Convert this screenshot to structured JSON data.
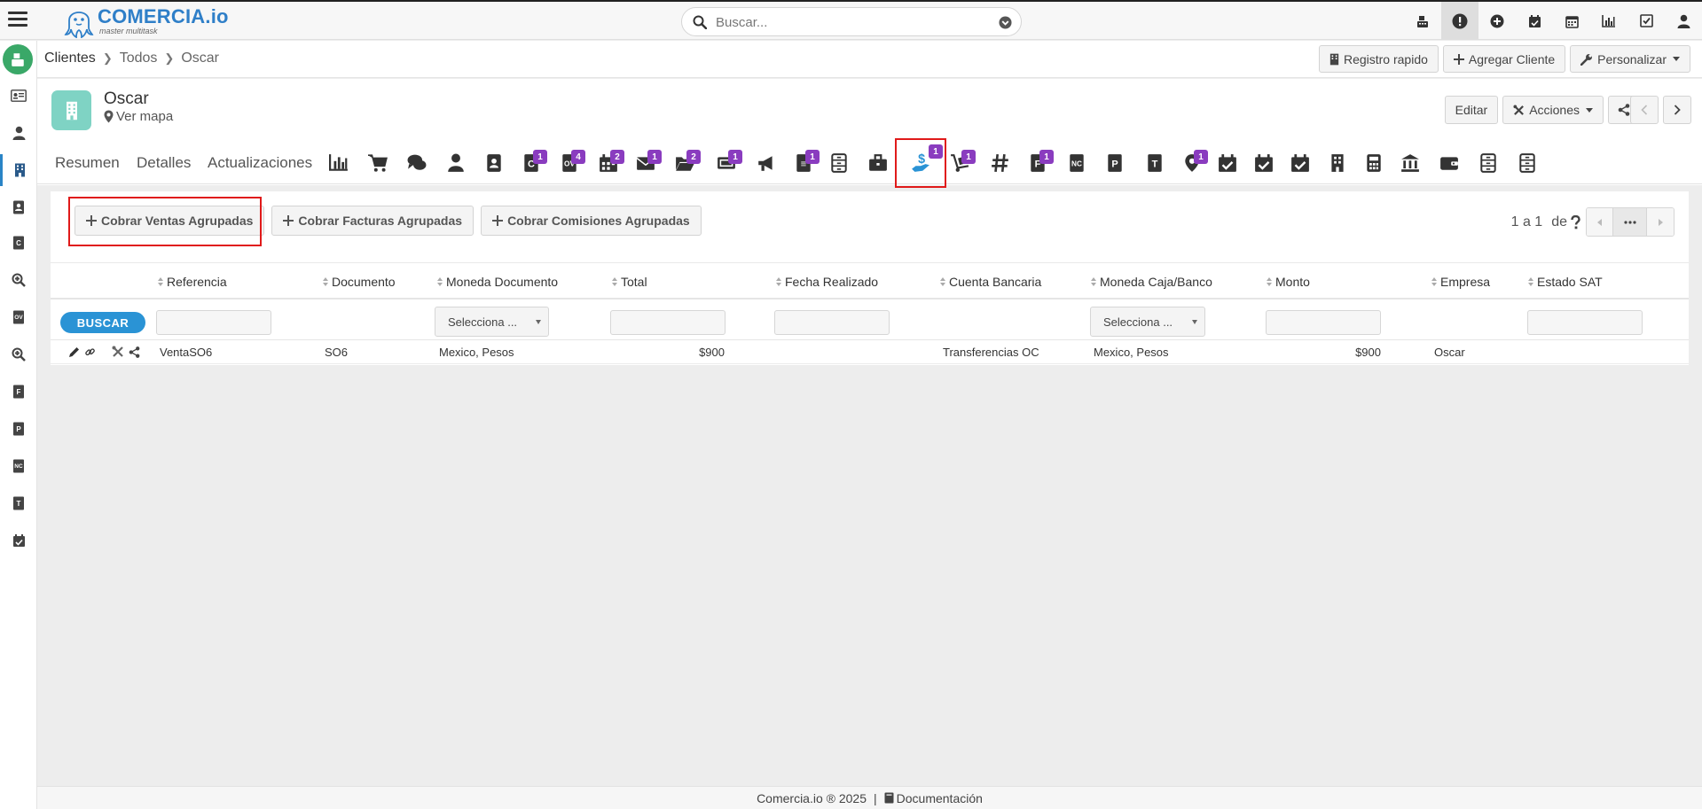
{
  "app": {
    "logo_name": "COMERCIA.io",
    "logo_tagline": "master multitask"
  },
  "search": {
    "placeholder": "Buscar..."
  },
  "top_icons": [
    "cash-register-icon",
    "alert-icon",
    "plus-circle-icon",
    "calendar-check-icon",
    "calendar-icon",
    "bar-chart-icon",
    "checkbox-icon",
    "user-icon"
  ],
  "breadcrumb": [
    "Clientes",
    "Todos",
    "Oscar"
  ],
  "header_actions": {
    "quick_register": "Registro rapido",
    "add_client": "Agregar Cliente",
    "customize": "Personalizar"
  },
  "record": {
    "name": "Oscar",
    "map_link": "Ver mapa",
    "edit_label": "Editar",
    "actions_label": "Acciones"
  },
  "tabs": {
    "text": [
      "Resumen",
      "Detalles",
      "Actualizaciones"
    ],
    "icons": [
      {
        "name": "bar-chart-icon",
        "badge": ""
      },
      {
        "name": "cart-icon",
        "badge": ""
      },
      {
        "name": "comments-icon",
        "badge": ""
      },
      {
        "name": "person-icon",
        "badge": ""
      },
      {
        "name": "contact-book-icon",
        "badge": ""
      },
      {
        "name": "c-document-icon",
        "badge": "1"
      },
      {
        "name": "ov-document-icon",
        "badge": "4"
      },
      {
        "name": "calendar-icon",
        "badge": "2"
      },
      {
        "name": "envelope-icon",
        "badge": "1"
      },
      {
        "name": "folder-open-icon",
        "badge": "2"
      },
      {
        "name": "ticket-icon",
        "badge": "1"
      },
      {
        "name": "megaphone-icon",
        "badge": ""
      },
      {
        "name": "document-icon",
        "badge": "1"
      },
      {
        "name": "cabinet-icon",
        "badge": ""
      },
      {
        "name": "briefcase-icon",
        "badge": ""
      },
      {
        "name": "hand-dollar-icon",
        "badge": "1"
      },
      {
        "name": "dolly-icon",
        "badge": "1"
      },
      {
        "name": "hashtag-icon",
        "badge": ""
      },
      {
        "name": "f-document-icon",
        "badge": "1"
      },
      {
        "name": "nc-document-icon",
        "badge": ""
      },
      {
        "name": "p-document-icon",
        "badge": ""
      },
      {
        "name": "t-document-icon",
        "badge": ""
      },
      {
        "name": "map-pin-icon",
        "badge": "1"
      },
      {
        "name": "calendar-check-icon",
        "badge": ""
      },
      {
        "name": "calendar-check-icon",
        "badge": ""
      },
      {
        "name": "calendar-check-icon",
        "badge": ""
      },
      {
        "name": "building-icon",
        "badge": ""
      },
      {
        "name": "calculator-icon",
        "badge": ""
      },
      {
        "name": "bank-icon",
        "badge": ""
      },
      {
        "name": "wallet-icon",
        "badge": ""
      },
      {
        "name": "cabinet-icon",
        "badge": ""
      },
      {
        "name": "cabinet-icon",
        "badge": ""
      }
    ]
  },
  "toolbar": {
    "group_sales": "Cobrar Ventas Agrupadas",
    "group_invoices": "Cobrar Facturas Agrupadas",
    "group_commissions": "Cobrar Comisiones Agrupadas"
  },
  "pager": {
    "text": "1 a 1",
    "of": "de"
  },
  "table": {
    "columns": [
      "Referencia",
      "Documento",
      "Moneda Documento",
      "Total",
      "Fecha Realizado",
      "Cuenta Bancaria",
      "Moneda Caja/Banco",
      "Monto",
      "Empresa",
      "Estado SAT"
    ],
    "search_button": "BUSCAR",
    "select_placeholder": "Selecciona ...",
    "rows": [
      {
        "referencia": "VentaSO6",
        "documento": "SO6",
        "moneda_documento": "Mexico, Pesos",
        "total": "$900",
        "fecha_realizado": "",
        "cuenta_bancaria": "Transferencias OC",
        "moneda_caja": "Mexico, Pesos",
        "monto": "$900",
        "empresa": "Oscar",
        "estado_sat": ""
      }
    ]
  },
  "footer": {
    "copyright": "Comercia.io ® 2025",
    "separator": "|",
    "docs": "Documentación"
  },
  "colors": {
    "accent_blue": "#2a93d5",
    "badge_purple": "#8a3cbf",
    "highlight_red": "#e01a1a",
    "home_green": "#3aa868"
  }
}
